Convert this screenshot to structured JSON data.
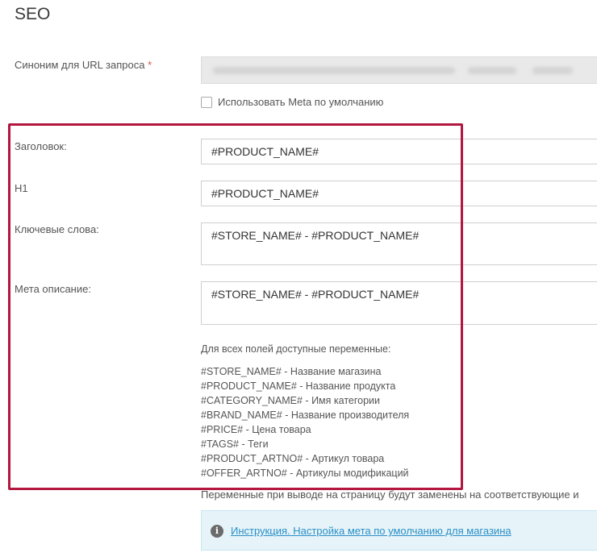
{
  "section": {
    "title": "SEO"
  },
  "url_alias": {
    "label": "Синоним для URL запроса",
    "required_mark": "*"
  },
  "default_meta": {
    "label": "Использовать Meta по умолчанию",
    "checked": false
  },
  "fields": {
    "title": {
      "label": "Заголовок:",
      "value": "#PRODUCT_NAME#"
    },
    "h1": {
      "label": "H1",
      "value": "#PRODUCT_NAME#"
    },
    "keywords": {
      "label": "Ключевые слова:",
      "value": "#STORE_NAME# - #PRODUCT_NAME#"
    },
    "description": {
      "label": "Мета описание:",
      "value": "#STORE_NAME# - #PRODUCT_NAME#"
    }
  },
  "variables": {
    "heading": "Для всех полей доступные переменные:",
    "items": [
      "#STORE_NAME# - Название магазина",
      "#PRODUCT_NAME# - Название продукта",
      "#CATEGORY_NAME# - Имя категории",
      "#BRAND_NAME# - Название производителя",
      "#PRICE# - Цена товара",
      "#TAGS# - Теги",
      "#PRODUCT_ARTNO# - Артикул товара",
      "#OFFER_ARTNO# - Артикулы модификаций"
    ]
  },
  "note": "Переменные при выводе на страницу будут заменены на соответствующие и",
  "info": {
    "link_text": "Инструкция. Настройка мета по умолчанию для магазина",
    "icon": "info-icon"
  },
  "colors": {
    "highlight": "#b3163f",
    "link": "#2a8fc7",
    "info_bg": "#e6f4f9"
  }
}
